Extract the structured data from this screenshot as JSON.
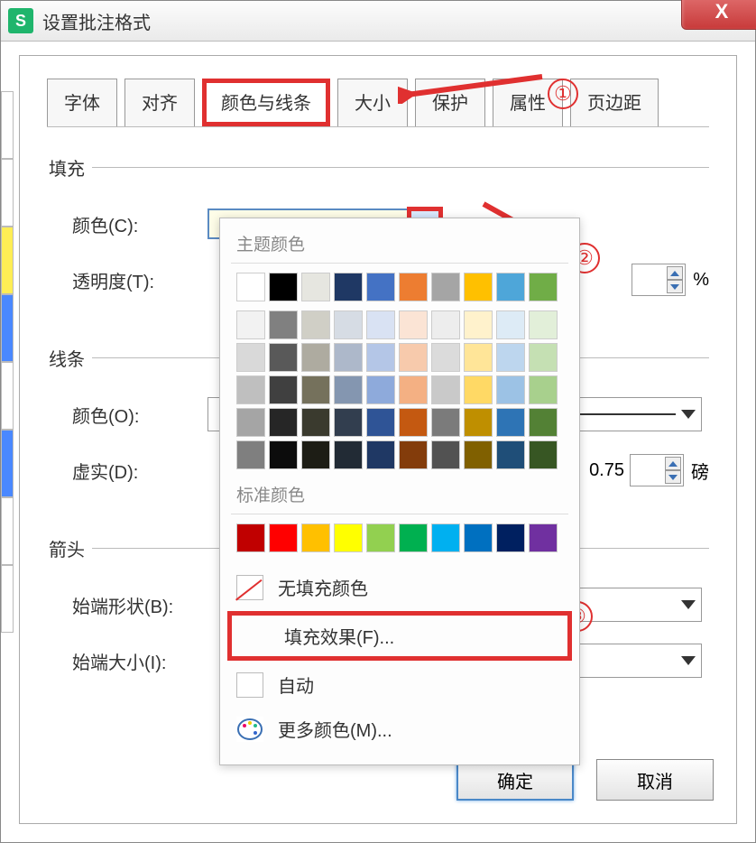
{
  "title": "设置批注格式",
  "app_icon_letter": "S",
  "close_glyph": "X",
  "tabs": [
    "字体",
    "对齐",
    "颜色与线条",
    "大小",
    "保护",
    "属性",
    "页边距"
  ],
  "active_tab_index": 2,
  "fill": {
    "legend": "填充",
    "color_label": "颜色(C):",
    "color_value_hex": "#fefde8",
    "transparency_label": "透明度(T):",
    "percent_sign": "%"
  },
  "line": {
    "legend": "线条",
    "color_label": "颜色(O):",
    "dash_label": "虚实(D):",
    "weight_value": "0.75",
    "weight_unit": "磅"
  },
  "arrow": {
    "legend": "箭头",
    "begin_shape_label": "始端形状(B):",
    "begin_size_label": "始端大小(I):"
  },
  "color_popup": {
    "theme_heading": "主题颜色",
    "standard_heading": "标准颜色",
    "theme_header_row": [
      "#ffffff",
      "#000000",
      "#e6e6e0",
      "#1f3864",
      "#4472c4",
      "#ed7d31",
      "#a5a5a5",
      "#ffc000",
      "#4ea6d9",
      "#70ad47"
    ],
    "theme_shade_grid": [
      [
        "#f2f2f2",
        "#808080",
        "#d0cfc6",
        "#d6dce4",
        "#d9e2f3",
        "#fbe4d5",
        "#ededed",
        "#fff2cc",
        "#ddebf6",
        "#e2efd9"
      ],
      [
        "#d9d9d9",
        "#595959",
        "#aeaba0",
        "#adb8ca",
        "#b4c6e7",
        "#f7caac",
        "#dbdbdb",
        "#ffe598",
        "#bdd6ee",
        "#c5e0b3"
      ],
      [
        "#bfbfbf",
        "#404040",
        "#75715c",
        "#8496b0",
        "#8eaadb",
        "#f4b083",
        "#c9c9c9",
        "#ffd965",
        "#9cc2e5",
        "#a8d08d"
      ],
      [
        "#a5a5a5",
        "#262626",
        "#3a3a2e",
        "#323e4f",
        "#2f5496",
        "#c45911",
        "#7b7b7b",
        "#bf8f00",
        "#2e74b5",
        "#538135"
      ],
      [
        "#7f7f7f",
        "#0c0c0c",
        "#1d1d15",
        "#222b35",
        "#1f3864",
        "#833c0b",
        "#525252",
        "#806000",
        "#1f4e78",
        "#375623"
      ]
    ],
    "standard_row": [
      "#c00000",
      "#ff0000",
      "#ffc000",
      "#ffff00",
      "#92d050",
      "#00b050",
      "#00b0f0",
      "#0070c0",
      "#002060",
      "#7030a0"
    ],
    "no_fill_label": "无填充颜色",
    "fill_effects_label": "填充效果(F)...",
    "auto_label": "自动",
    "more_colors_label": "更多颜色(M)..."
  },
  "buttons": {
    "ok": "确定",
    "cancel": "取消"
  },
  "annotations": {
    "one": "①",
    "two": "②",
    "three": "③"
  }
}
